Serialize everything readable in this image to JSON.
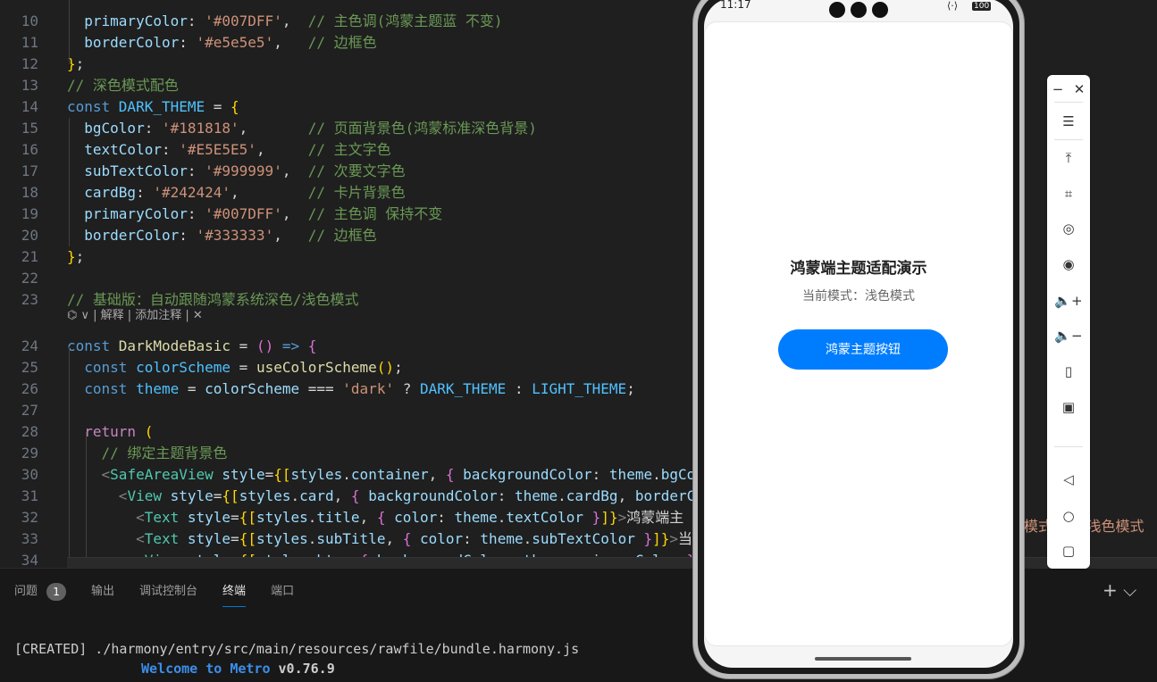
{
  "editor": {
    "lines": [
      {
        "n": "10",
        "tokens": [
          [
            "  ",
            "w"
          ],
          [
            "primaryColor",
            "p"
          ],
          [
            ": ",
            "w"
          ],
          [
            "'#007DFF'",
            "s"
          ],
          [
            ",  ",
            "w"
          ],
          [
            "// 主色调(鸿蒙主题蓝 不变)",
            "c"
          ]
        ]
      },
      {
        "n": "11",
        "tokens": [
          [
            "  ",
            "w"
          ],
          [
            "borderColor",
            "p"
          ],
          [
            ": ",
            "w"
          ],
          [
            "'#e5e5e5'",
            "s"
          ],
          [
            ",   ",
            "w"
          ],
          [
            "// 边框色",
            "c"
          ]
        ]
      },
      {
        "n": "12",
        "tokens": [
          [
            "}",
            "y"
          ],
          [
            ";",
            "w"
          ]
        ]
      },
      {
        "n": "13",
        "tokens": [
          [
            "// 深色模式配色",
            "c"
          ]
        ]
      },
      {
        "n": "14",
        "tokens": [
          [
            "const ",
            "k"
          ],
          [
            "DARK_THEME",
            "v"
          ],
          [
            " = ",
            "w"
          ],
          [
            "{",
            "y"
          ]
        ]
      },
      {
        "n": "15",
        "tokens": [
          [
            "  ",
            "w"
          ],
          [
            "bgColor",
            "p"
          ],
          [
            ": ",
            "w"
          ],
          [
            "'#181818'",
            "s"
          ],
          [
            ",       ",
            "w"
          ],
          [
            "// 页面背景色(鸿蒙标准深色背景)",
            "c"
          ]
        ]
      },
      {
        "n": "16",
        "tokens": [
          [
            "  ",
            "w"
          ],
          [
            "textColor",
            "p"
          ],
          [
            ": ",
            "w"
          ],
          [
            "'#E5E5E5'",
            "s"
          ],
          [
            ",     ",
            "w"
          ],
          [
            "// 主文字色",
            "c"
          ]
        ]
      },
      {
        "n": "17",
        "tokens": [
          [
            "  ",
            "w"
          ],
          [
            "subTextColor",
            "p"
          ],
          [
            ": ",
            "w"
          ],
          [
            "'#999999'",
            "s"
          ],
          [
            ",  ",
            "w"
          ],
          [
            "// 次要文字色",
            "c"
          ]
        ]
      },
      {
        "n": "18",
        "tokens": [
          [
            "  ",
            "w"
          ],
          [
            "cardBg",
            "p"
          ],
          [
            ": ",
            "w"
          ],
          [
            "'#242424'",
            "s"
          ],
          [
            ",        ",
            "w"
          ],
          [
            "// 卡片背景色",
            "c"
          ]
        ]
      },
      {
        "n": "19",
        "tokens": [
          [
            "  ",
            "w"
          ],
          [
            "primaryColor",
            "p"
          ],
          [
            ": ",
            "w"
          ],
          [
            "'#007DFF'",
            "s"
          ],
          [
            ",  ",
            "w"
          ],
          [
            "// 主色调 保持不变",
            "c"
          ]
        ]
      },
      {
        "n": "20",
        "tokens": [
          [
            "  ",
            "w"
          ],
          [
            "borderColor",
            "p"
          ],
          [
            ": ",
            "w"
          ],
          [
            "'#333333'",
            "s"
          ],
          [
            ",   ",
            "w"
          ],
          [
            "// 边框色",
            "c"
          ]
        ]
      },
      {
        "n": "21",
        "tokens": [
          [
            "}",
            "y"
          ],
          [
            ";",
            "w"
          ]
        ]
      },
      {
        "n": "22",
        "tokens": []
      },
      {
        "n": "23",
        "tokens": [
          [
            "// 基础版：自动跟随鸿蒙系统深色/浅色模式",
            "c"
          ]
        ]
      },
      {
        "n": "24",
        "tokens": [
          [
            "const ",
            "k"
          ],
          [
            "DarkModeBasic",
            "f"
          ],
          [
            " = ",
            "w"
          ],
          [
            "()",
            "m"
          ],
          [
            " ",
            "w"
          ],
          [
            "=>",
            "k"
          ],
          [
            " ",
            "w"
          ],
          [
            "{",
            "m"
          ]
        ]
      },
      {
        "n": "25",
        "tokens": [
          [
            "  ",
            "w"
          ],
          [
            "const ",
            "k"
          ],
          [
            "colorScheme",
            "v"
          ],
          [
            " = ",
            "w"
          ],
          [
            "useColorScheme",
            "f"
          ],
          [
            "()",
            "y"
          ],
          [
            ";",
            "w"
          ]
        ]
      },
      {
        "n": "26",
        "tokens": [
          [
            "  ",
            "w"
          ],
          [
            "const ",
            "k"
          ],
          [
            "theme",
            "v"
          ],
          [
            " = ",
            "w"
          ],
          [
            "colorScheme",
            "p"
          ],
          [
            " === ",
            "w"
          ],
          [
            "'dark'",
            "s"
          ],
          [
            " ? ",
            "w"
          ],
          [
            "DARK_THEME",
            "v"
          ],
          [
            " : ",
            "w"
          ],
          [
            "LIGHT_THEME",
            "v"
          ],
          [
            ";",
            "w"
          ]
        ]
      },
      {
        "n": "27",
        "tokens": []
      },
      {
        "n": "28",
        "tokens": [
          [
            "  ",
            "w"
          ],
          [
            "return ",
            "r"
          ],
          [
            "(",
            "y"
          ]
        ]
      },
      {
        "n": "29",
        "tokens": [
          [
            "    ",
            "w"
          ],
          [
            "// 绑定主题背景色",
            "c"
          ]
        ]
      },
      {
        "n": "30",
        "tokens": [
          [
            "    ",
            "w"
          ],
          [
            "<",
            "g"
          ],
          [
            "SafeAreaView",
            "t"
          ],
          [
            " ",
            "w"
          ],
          [
            "style",
            "p"
          ],
          [
            "=",
            "w"
          ],
          [
            "{[",
            "y"
          ],
          [
            "styles",
            "p"
          ],
          [
            ".",
            "w"
          ],
          [
            "container",
            "p"
          ],
          [
            ", ",
            "w"
          ],
          [
            "{ ",
            "m"
          ],
          [
            "backgroundColor",
            "p"
          ],
          [
            ": ",
            "w"
          ],
          [
            "theme",
            "p"
          ],
          [
            ".",
            "w"
          ],
          [
            "bgCo",
            "p"
          ]
        ]
      },
      {
        "n": "31",
        "tokens": [
          [
            "      ",
            "w"
          ],
          [
            "<",
            "g"
          ],
          [
            "View",
            "t"
          ],
          [
            " ",
            "w"
          ],
          [
            "style",
            "p"
          ],
          [
            "=",
            "w"
          ],
          [
            "{[",
            "y"
          ],
          [
            "styles",
            "p"
          ],
          [
            ".",
            "w"
          ],
          [
            "card",
            "p"
          ],
          [
            ", ",
            "w"
          ],
          [
            "{ ",
            "m"
          ],
          [
            "backgroundColor",
            "p"
          ],
          [
            ": ",
            "w"
          ],
          [
            "theme",
            "p"
          ],
          [
            ".",
            "w"
          ],
          [
            "cardBg",
            "p"
          ],
          [
            ", ",
            "w"
          ],
          [
            "borderC",
            "p"
          ]
        ]
      },
      {
        "n": "32",
        "tokens": [
          [
            "        ",
            "w"
          ],
          [
            "<",
            "g"
          ],
          [
            "Text",
            "t"
          ],
          [
            " ",
            "w"
          ],
          [
            "style",
            "p"
          ],
          [
            "=",
            "w"
          ],
          [
            "{[",
            "y"
          ],
          [
            "styles",
            "p"
          ],
          [
            ".",
            "w"
          ],
          [
            "title",
            "p"
          ],
          [
            ", ",
            "w"
          ],
          [
            "{ ",
            "m"
          ],
          [
            "color",
            "p"
          ],
          [
            ": ",
            "w"
          ],
          [
            "theme",
            "p"
          ],
          [
            ".",
            "w"
          ],
          [
            "textColor",
            "p"
          ],
          [
            " }",
            "m"
          ],
          [
            "]}",
            "y"
          ],
          [
            ">",
            "g"
          ],
          [
            "鸿蒙端主",
            "w"
          ]
        ]
      },
      {
        "n": "33",
        "tokens": [
          [
            "        ",
            "w"
          ],
          [
            "<",
            "g"
          ],
          [
            "Text",
            "t"
          ],
          [
            " ",
            "w"
          ],
          [
            "style",
            "p"
          ],
          [
            "=",
            "w"
          ],
          [
            "{[",
            "y"
          ],
          [
            "styles",
            "p"
          ],
          [
            ".",
            "w"
          ],
          [
            "subTitle",
            "p"
          ],
          [
            ", ",
            "w"
          ],
          [
            "{ ",
            "m"
          ],
          [
            "color",
            "p"
          ],
          [
            ": ",
            "w"
          ],
          [
            "theme",
            "p"
          ],
          [
            ".",
            "w"
          ],
          [
            "subTextColor",
            "p"
          ],
          [
            " }",
            "m"
          ],
          [
            "]}",
            "y"
          ],
          [
            ">",
            "g"
          ],
          [
            "当",
            "w"
          ]
        ]
      },
      {
        "n": "34",
        "tokens": [
          [
            "        ",
            "w"
          ],
          [
            "<",
            "g"
          ],
          [
            "View",
            "t"
          ],
          [
            " ",
            "w"
          ],
          [
            "style",
            "p"
          ],
          [
            "=",
            "w"
          ],
          [
            "{[",
            "y"
          ],
          [
            "styles",
            "p"
          ],
          [
            ".",
            "w"
          ],
          [
            "btn",
            "p"
          ],
          [
            ", ",
            "w"
          ],
          [
            "{ ",
            "m"
          ],
          [
            "backgroundColor",
            "p"
          ],
          [
            ": ",
            "w"
          ],
          [
            "theme",
            "p"
          ],
          [
            ".",
            "w"
          ],
          [
            "primaryColor",
            "p"
          ],
          [
            " }",
            "m"
          ]
        ]
      }
    ],
    "codelens": "⌬ ∨  | 解释 | 添加注释 |  ✕",
    "bleed_text": "模式 : '浅色模式"
  },
  "panel": {
    "tabs": [
      {
        "label": "问题",
        "badge": "1",
        "active": false
      },
      {
        "label": "输出",
        "active": false
      },
      {
        "label": "调试控制台",
        "active": false
      },
      {
        "label": "终端",
        "active": true
      },
      {
        "label": "端口",
        "active": false
      }
    ],
    "tools": "+ ⌵",
    "terminal": {
      "line1": "[CREATED] ./harmony/entry/src/main/resources/rawfile/bundle.harmony.js",
      "line2_prefix": "Welcome to Metro",
      "line2_version": " v0.76.9"
    }
  },
  "phone": {
    "time": "11:17",
    "battery": "100",
    "title": "鸿蒙端主题适配演示",
    "subtitle": "当前模式：浅色模式",
    "button_label": "鸿蒙主题按钮",
    "colors": {
      "primary": "#007DFF",
      "card": "#ffffff"
    }
  },
  "emulator_toolbar": {
    "buttons": [
      {
        "name": "minimize-icon",
        "glyph": "−"
      },
      {
        "name": "close-icon",
        "glyph": "✕"
      },
      {
        "name": "menu-icon",
        "glyph": "☰"
      },
      {
        "name": "pin-top-icon",
        "glyph": "⤒"
      },
      {
        "name": "crop-screenshot-icon",
        "glyph": "⌗"
      },
      {
        "name": "rotate-icon",
        "glyph": "◎"
      },
      {
        "name": "record-icon",
        "glyph": "◉"
      },
      {
        "name": "volume-up-icon",
        "glyph": "🔈+"
      },
      {
        "name": "volume-down-icon",
        "glyph": "🔈−"
      },
      {
        "name": "shake-icon",
        "glyph": "▯"
      },
      {
        "name": "multi-device-icon",
        "glyph": "▣"
      },
      {
        "name": "back-icon",
        "glyph": "◁"
      },
      {
        "name": "home-icon",
        "glyph": "○"
      },
      {
        "name": "recents-icon",
        "glyph": "▢"
      }
    ]
  }
}
